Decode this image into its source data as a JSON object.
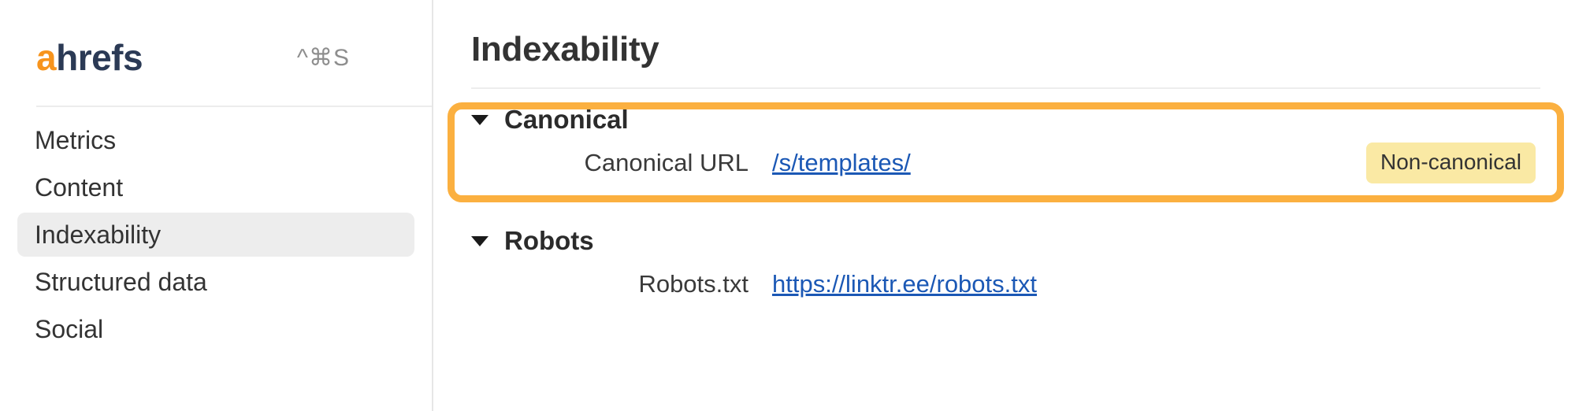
{
  "sidebar": {
    "logo": {
      "accent": "a",
      "rest": "hrefs",
      "accent_color": "#f7941d",
      "rest_color": "#2b3a55"
    },
    "shortcut": "^⌘S",
    "items": [
      {
        "label": "Metrics",
        "active": false
      },
      {
        "label": "Content",
        "active": false
      },
      {
        "label": "Indexability",
        "active": true
      },
      {
        "label": "Structured data",
        "active": false
      },
      {
        "label": "Social",
        "active": false
      }
    ]
  },
  "main": {
    "title": "Indexability",
    "sections": [
      {
        "title": "Canonical",
        "expanded": true,
        "highlighted": true,
        "rows": [
          {
            "label": "Canonical URL",
            "value": "/s/templates/",
            "badge": "Non-canonical"
          }
        ]
      },
      {
        "title": "Robots",
        "expanded": true,
        "highlighted": false,
        "rows": [
          {
            "label": "Robots.txt",
            "value": "https://linktr.ee/robots.txt",
            "badge": ""
          }
        ]
      }
    ]
  },
  "colors": {
    "highlight_border": "#fbb040",
    "badge_background": "#fae9a4",
    "link": "#1b58b5",
    "active_nav_background": "#ededed"
  }
}
